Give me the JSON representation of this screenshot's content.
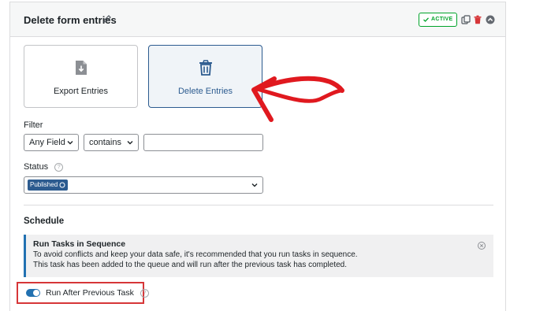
{
  "header": {
    "title": "Delete form entries",
    "badge": "ACTIVE"
  },
  "tiles": [
    {
      "label": "Export Entries",
      "icon": "file-download-icon"
    },
    {
      "label": "Delete Entries",
      "icon": "trash-icon"
    }
  ],
  "filter": {
    "label": "Filter",
    "field_value": "Any Field",
    "operator_value": "contains",
    "text_value": ""
  },
  "status": {
    "label": "Status",
    "help": "?",
    "tag": "Published"
  },
  "schedule": {
    "heading": "Schedule"
  },
  "notice": {
    "title": "Run Tasks in Sequence",
    "line1": "To avoid conflicts and keep your data safe, it's recommended that you run tasks in sequence.",
    "line2": "This task has been added to the queue and will run after the previous task has completed."
  },
  "toggle": {
    "label": "Run After Previous Task",
    "help": "?",
    "on": true
  },
  "colors": {
    "accent": "#2271b1",
    "active_green": "#00a32a",
    "annotation_red": "#e0191f"
  }
}
